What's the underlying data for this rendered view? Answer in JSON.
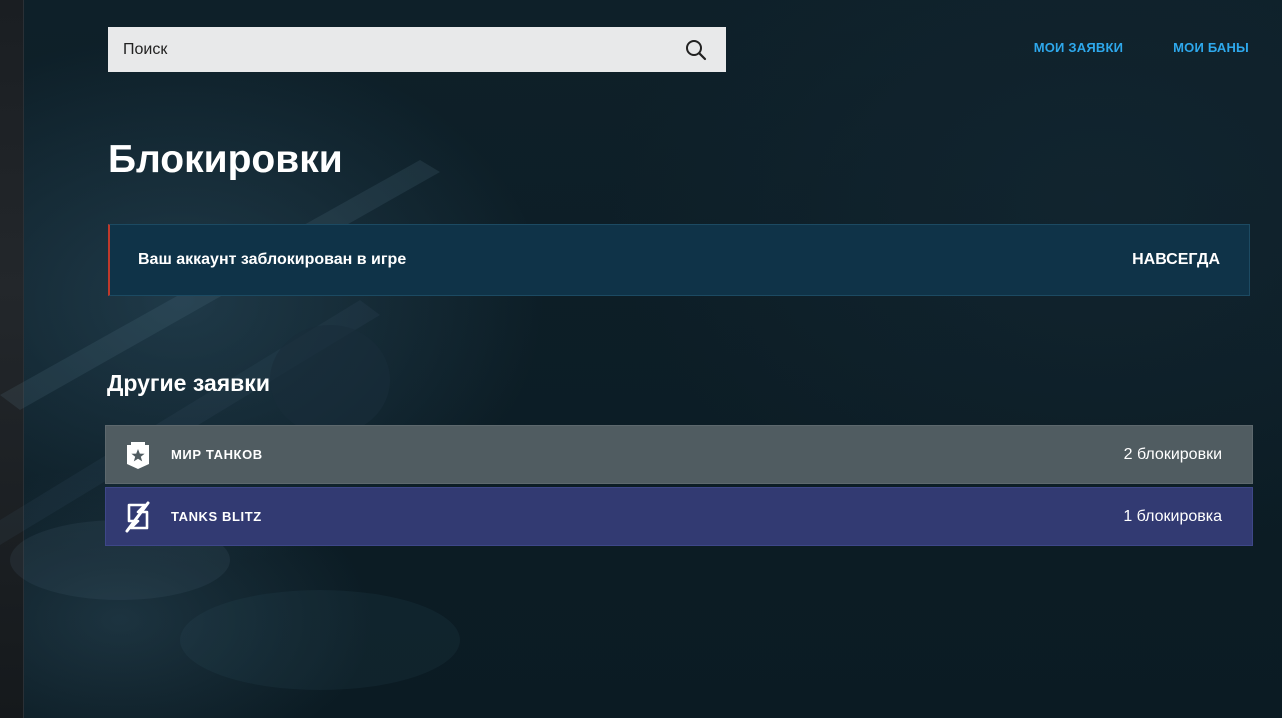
{
  "search": {
    "placeholder": "Поиск"
  },
  "nav": {
    "my_requests": "МОИ ЗАЯВКИ",
    "my_bans": "МОИ БАНЫ"
  },
  "page": {
    "title": "Блокировки"
  },
  "ban": {
    "text": "Ваш аккаунт заблокирован в игре",
    "duration": "НАВСЕГДА"
  },
  "other": {
    "title": "Другие заявки",
    "games": [
      {
        "name": "МИР ТАНКОВ",
        "count": "2 блокировки",
        "icon": "tank-star-shield-icon"
      },
      {
        "name": "TANKS BLITZ",
        "count": "1 блокировка",
        "icon": "blitz-lightning-icon"
      }
    ]
  },
  "colors": {
    "accent_link": "#2ea8ec",
    "ban_marker": "#c0392b",
    "row_world_of_tanks": "#505c61",
    "row_tanks_blitz": "#323a72"
  }
}
